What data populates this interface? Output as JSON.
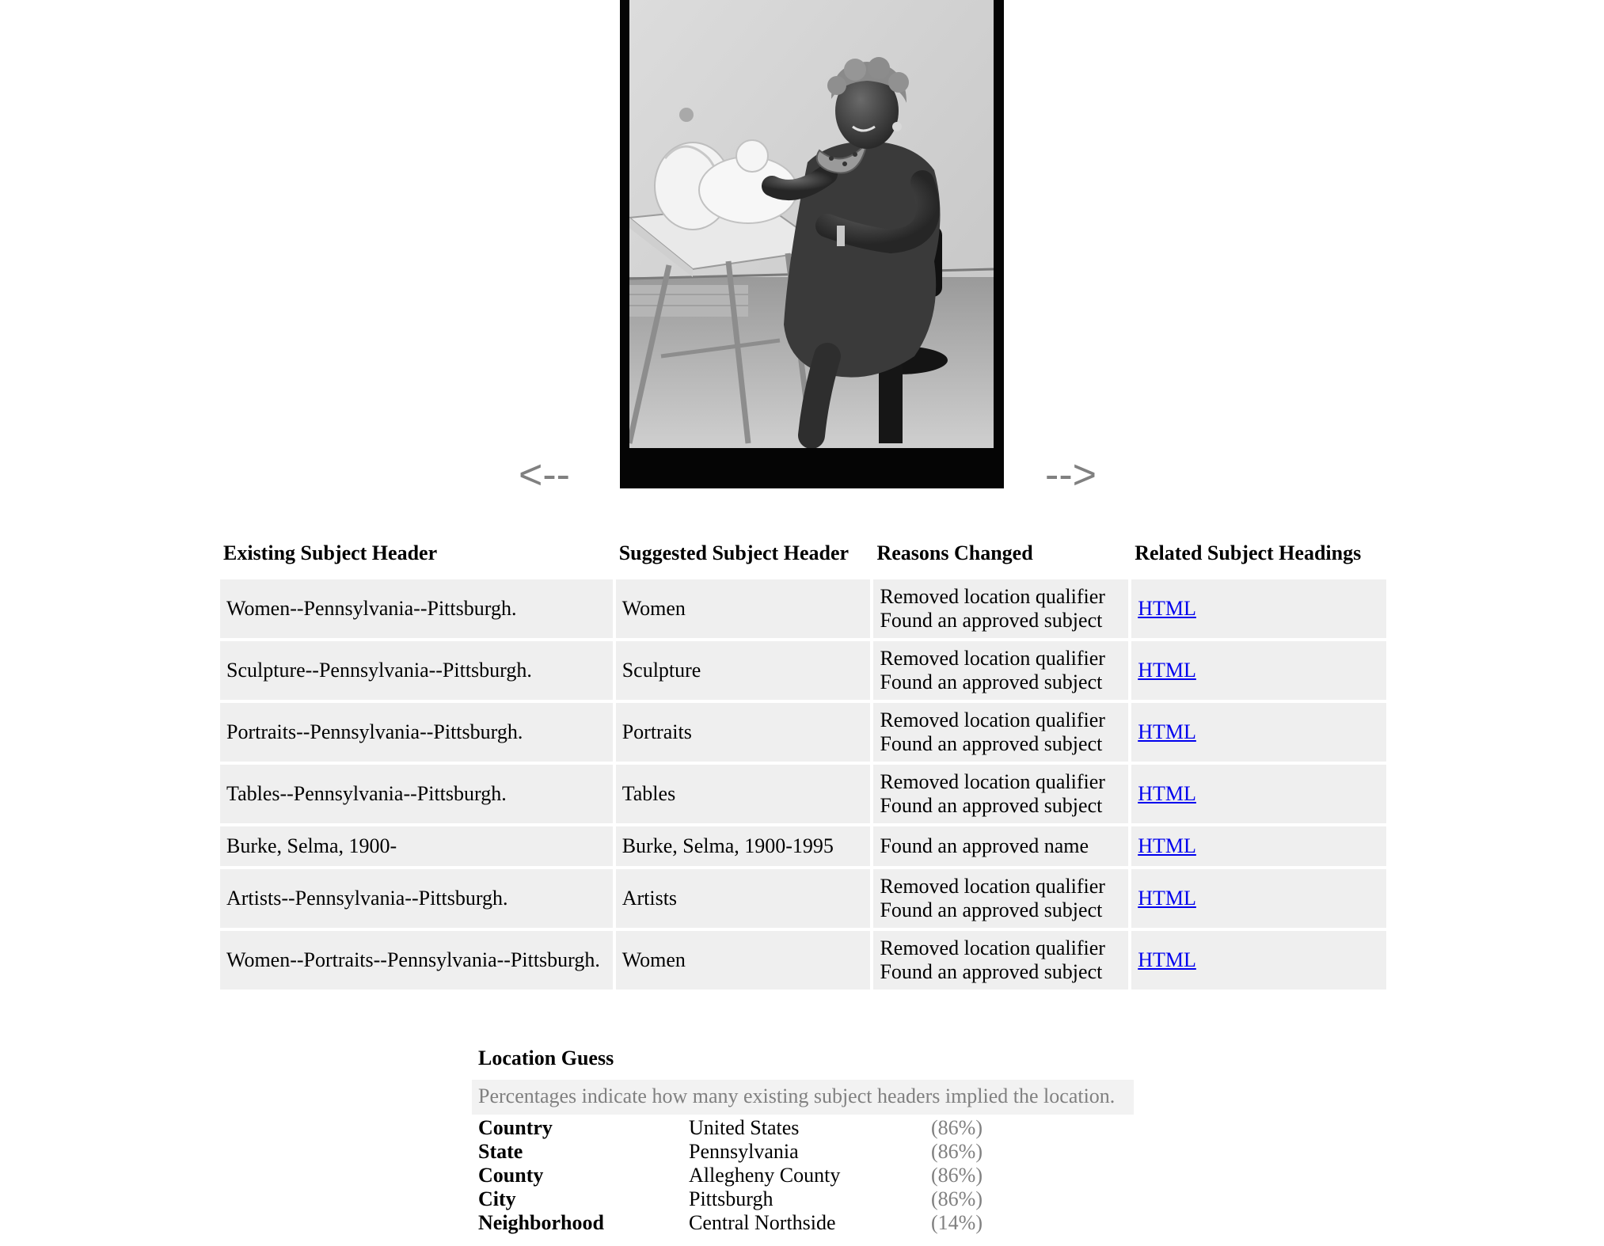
{
  "nav": {
    "prev_label": "<--",
    "next_label": "-->"
  },
  "table": {
    "headers": {
      "existing": "Existing Subject Header",
      "suggested": "Suggested Subject Header",
      "reasons": "Reasons Changed",
      "related": "Related Subject Headings"
    },
    "rows": [
      {
        "existing": "Women--Pennsylvania--Pittsburgh.",
        "suggested": "Women",
        "reason_1": "Removed location qualifier",
        "reason_2": "Found an approved subject",
        "related": "HTML"
      },
      {
        "existing": "Sculpture--Pennsylvania--Pittsburgh.",
        "suggested": "Sculpture",
        "reason_1": "Removed location qualifier",
        "reason_2": "Found an approved subject",
        "related": "HTML"
      },
      {
        "existing": "Portraits--Pennsylvania--Pittsburgh.",
        "suggested": "Portraits",
        "reason_1": "Removed location qualifier",
        "reason_2": "Found an approved subject",
        "related": "HTML"
      },
      {
        "existing": "Tables--Pennsylvania--Pittsburgh.",
        "suggested": "Tables",
        "reason_1": "Removed location qualifier",
        "reason_2": "Found an approved subject",
        "related": "HTML"
      },
      {
        "existing": "Burke, Selma, 1900-",
        "suggested": "Burke, Selma, 1900-1995",
        "reason_1": "Found an approved name",
        "related": "HTML"
      },
      {
        "existing": "Artists--Pennsylvania--Pittsburgh.",
        "suggested": "Artists",
        "reason_1": "Removed location qualifier",
        "reason_2": "Found an approved subject",
        "related": "HTML"
      },
      {
        "existing": "Women--Portraits--Pennsylvania--Pittsburgh.",
        "suggested": "Women",
        "reason_1": "Removed location qualifier",
        "reason_2": "Found an approved subject",
        "related": "HTML"
      }
    ]
  },
  "location": {
    "title": "Location Guess",
    "note": "Percentages indicate how many existing subject headers implied the location.",
    "rows": [
      {
        "label": "Country",
        "value": "United States",
        "pct": "(86%)"
      },
      {
        "label": "State",
        "value": "Pennsylvania",
        "pct": "(86%)"
      },
      {
        "label": "County",
        "value": "Allegheny County",
        "pct": "(86%)"
      },
      {
        "label": "City",
        "value": "Pittsburgh",
        "pct": "(86%)"
      },
      {
        "label": "Neighborhood",
        "value": "Central Northside",
        "pct": "(14%)"
      }
    ]
  },
  "colors": {
    "link": "#0000ee",
    "cell_background": "#efefef",
    "muted_text": "#808080",
    "photo_border": "#050505"
  }
}
